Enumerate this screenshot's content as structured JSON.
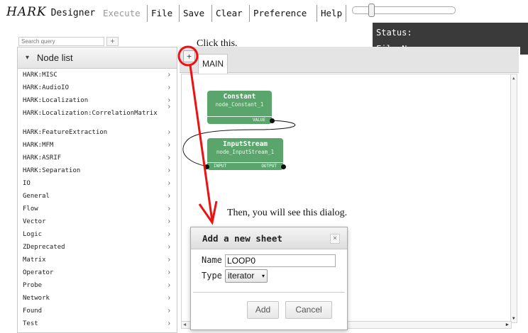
{
  "app": {
    "logo_main": "HARK",
    "logo_sub": "Designer"
  },
  "menu": {
    "execute": "Execute",
    "file": "File",
    "save": "Save",
    "clear": "Clear",
    "preference": "Preference",
    "help": "Help"
  },
  "status": {
    "status_label": "Status:",
    "filename_label": "File Name:"
  },
  "sidebar": {
    "search_placeholder": "Search query",
    "add_label": "+",
    "header_caret": "▾",
    "header_title": "Node list",
    "items": [
      "HARK:MISC",
      "HARK:AudioIO",
      "HARK:Localization",
      "HARK:Localization:CorrelationMatrix",
      "HARK:FeatureExtraction",
      "HARK:MFM",
      "HARK:ASRIF",
      "HARK:Separation",
      "IO",
      "General",
      "Flow",
      "Vector",
      "Logic",
      "ZDeprecated",
      "Matrix",
      "Operator",
      "Probe",
      "Network",
      "Found",
      "Test"
    ],
    "chevron": "›"
  },
  "main": {
    "add_sheet_label": "+",
    "tabs": [
      {
        "label": "MAIN"
      }
    ]
  },
  "nodes": {
    "constant": {
      "title": "Constant",
      "id": "node_Constant_1",
      "out_port": "VALUE"
    },
    "inputstream": {
      "title": "InputStream",
      "id": "node_InputStream_1",
      "in_port": "INPUT",
      "out_port": "OUTPUT"
    }
  },
  "annotations": {
    "click_note": "Click this.",
    "dialog_note": "Then, you will see this dialog.",
    "highlight_color": "#ee1111"
  },
  "dialog": {
    "title": "Add a new sheet",
    "close_label": "×",
    "name_label": "Name",
    "name_value": "LOOP0",
    "type_label": "Type",
    "type_value": "iterator",
    "type_arrow": "▾",
    "add_label": "Add",
    "cancel_label": "Cancel"
  },
  "colors": {
    "node_green": "#5aa56c",
    "status_bg": "#3a3a3a"
  }
}
